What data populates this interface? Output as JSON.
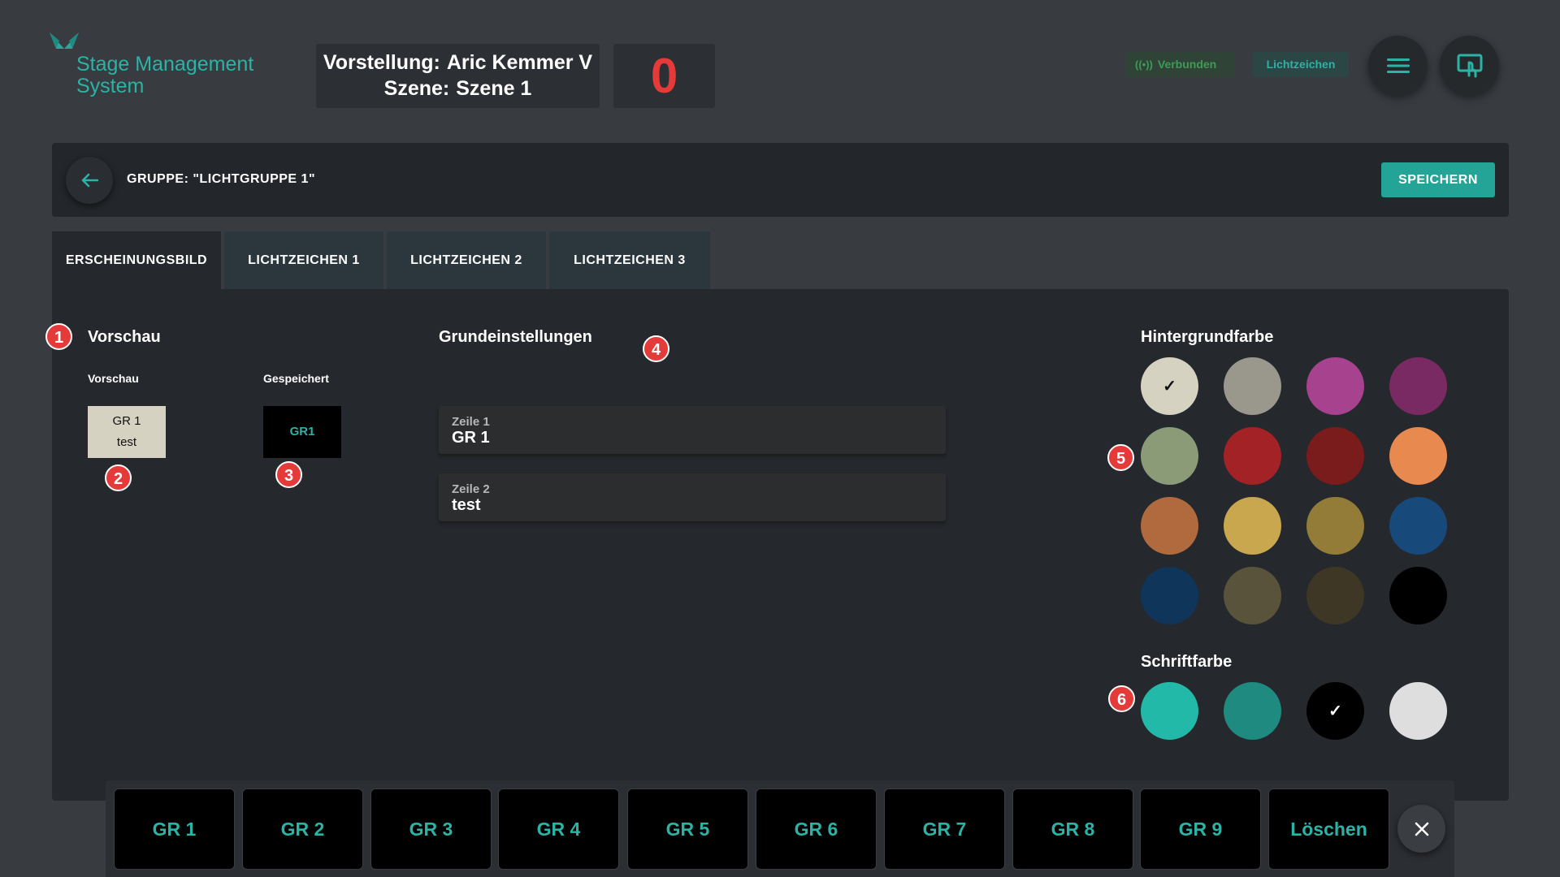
{
  "header": {
    "app_name_line1": "Stage Management",
    "app_name_line2": "System",
    "show_label": "Vorstellung:",
    "show_value": "Aric Kemmer V",
    "scene_label": "Szene:",
    "scene_value": "Szene 1",
    "counter": "0",
    "status_chip": "Verbunden",
    "mode_chip": "Lichtzeichen",
    "icons": {
      "menu": "hamburger-icon",
      "screen": "touch-screen-icon",
      "status": "broadcast-icon"
    }
  },
  "group_bar": {
    "title": "GRUPPE: \"LICHTGRUPPE 1\"",
    "save_label": "SPEICHERN",
    "back_icon": "arrow-left-icon"
  },
  "tabs": [
    {
      "label": "ERSCHEINUNGSBILD",
      "active": true
    },
    {
      "label": "LICHTZEICHEN 1",
      "active": false
    },
    {
      "label": "LICHTZEICHEN 2",
      "active": false
    },
    {
      "label": "LICHTZEICHEN 3",
      "active": false
    }
  ],
  "preview": {
    "title": "Vorschau",
    "preview_label": "Vorschau",
    "saved_label": "Gespeichert",
    "preview_line1": "GR 1",
    "preview_line2": "test",
    "saved_text": "GR1"
  },
  "settings": {
    "title": "Grundeinstellungen",
    "fields": [
      {
        "label": "Zeile 1",
        "value": "GR 1"
      },
      {
        "label": "Zeile 2",
        "value": "test"
      }
    ]
  },
  "background_colors": {
    "title": "Hintergrundfarbe",
    "selected_index": 0,
    "swatches": [
      "#d6d2c2",
      "#9a978c",
      "#a6428e",
      "#7a2a63",
      "#8b9b78",
      "#a32226",
      "#7a1c1c",
      "#e8894f",
      "#b06a3e",
      "#c9a74e",
      "#927c38",
      "#174a7a",
      "#0f355a",
      "#5a533b",
      "#3e3725",
      "#000000"
    ]
  },
  "font_colors": {
    "title": "Schriftfarbe",
    "selected_index": 2,
    "swatches": [
      "#23b9a9",
      "#1f8a7f",
      "#000000",
      "#dedede"
    ]
  },
  "annotations": [
    "1",
    "2",
    "3",
    "4",
    "5",
    "6"
  ],
  "bottom_bar": {
    "buttons": [
      "GR 1",
      "GR 2",
      "GR 3",
      "GR 4",
      "GR 5",
      "GR 6",
      "GR 7",
      "GR 8",
      "GR 9",
      "Löschen"
    ],
    "close_icon": "close-icon"
  },
  "colors": {
    "accent": "#2bb3a6",
    "danger": "#e53a3a",
    "background": "#383b40",
    "panel": "#25282c"
  }
}
